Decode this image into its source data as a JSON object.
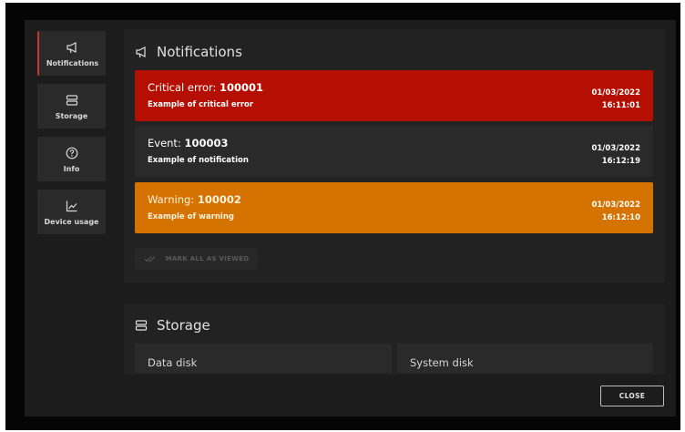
{
  "sidebar": {
    "items": [
      {
        "label": "Notifications",
        "icon": "megaphone-icon",
        "active": true
      },
      {
        "label": "Storage",
        "icon": "storage-icon"
      },
      {
        "label": "Info",
        "icon": "question-icon"
      },
      {
        "label": "Device usage",
        "icon": "chart-icon"
      }
    ]
  },
  "notifications": {
    "title": "Notifications",
    "items": [
      {
        "prefix": "Critical error: ",
        "code": "100001",
        "message": "Example of critical error",
        "date": "01/03/2022",
        "time": "16:11:01",
        "color": "#b40f02"
      },
      {
        "prefix": "Event: ",
        "code": "100003",
        "message": "Example of notification",
        "date": "01/03/2022",
        "time": "16:12:19",
        "color": "#2a2a2a"
      },
      {
        "prefix": "Warning: ",
        "code": "100002",
        "message": "Example of warning",
        "date": "01/03/2022",
        "time": "16:12:10",
        "color": "#d57300"
      }
    ],
    "mark_all_label": "MARK ALL AS VIEWED"
  },
  "storage": {
    "title": "Storage",
    "disks": [
      {
        "label": "Data disk"
      },
      {
        "label": "System disk"
      }
    ]
  },
  "close_label": "CLOSE",
  "colors": {
    "accent": "#c0392b",
    "panel": "#1c1c1c",
    "section": "#222222"
  }
}
